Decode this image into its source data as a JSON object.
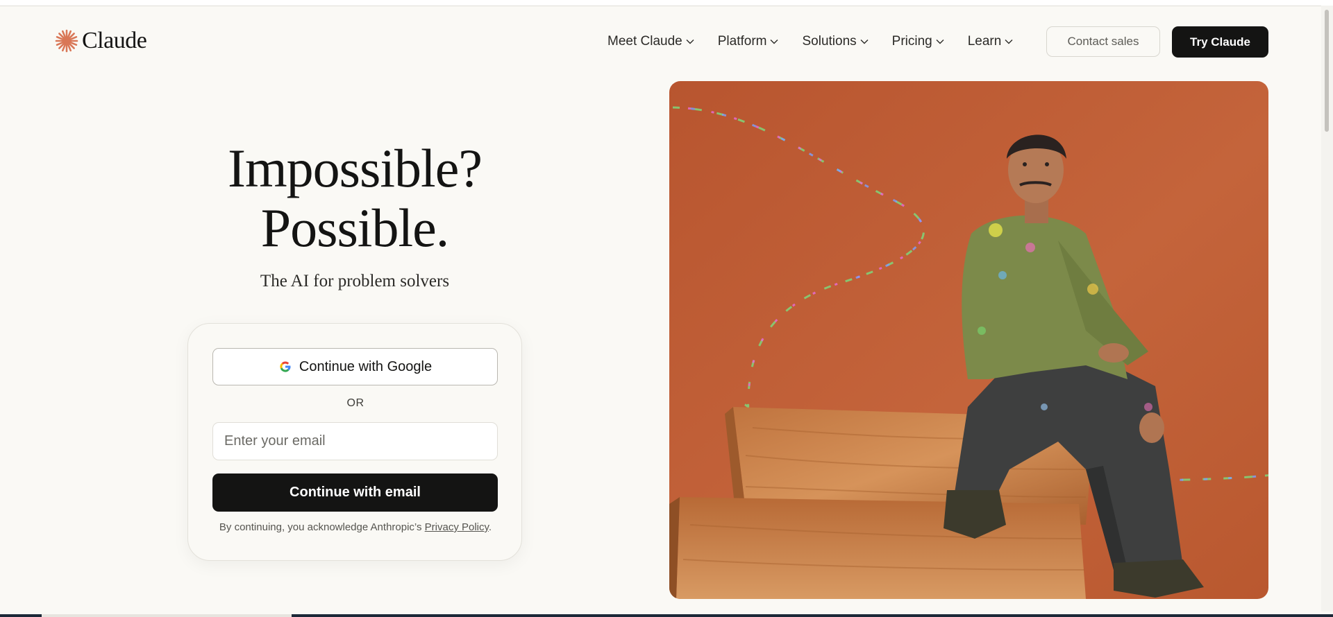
{
  "brand": {
    "name": "Claude",
    "logo_icon": "claude-spark-icon",
    "accent": "#d97757"
  },
  "nav": {
    "items": [
      {
        "label": "Meet Claude",
        "icon": "chevron-down-icon"
      },
      {
        "label": "Platform",
        "icon": "chevron-down-icon"
      },
      {
        "label": "Solutions",
        "icon": "chevron-down-icon"
      },
      {
        "label": "Pricing",
        "icon": "chevron-down-icon"
      },
      {
        "label": "Learn",
        "icon": "chevron-down-icon"
      }
    ],
    "contact_label": "Contact sales",
    "try_label": "Try Claude"
  },
  "hero": {
    "title_line1": "Impossible?",
    "title_line2": "Possible.",
    "subtitle": "The AI for problem solvers"
  },
  "signin": {
    "google_label": "Continue with Google",
    "google_icon": "google-g-icon",
    "divider": "OR",
    "email_placeholder": "Enter your email",
    "email_value": "",
    "email_button": "Continue with email",
    "legal_prefix": "By continuing, you acknowledge Anthropic’s ",
    "legal_link": "Privacy Policy",
    "legal_suffix": "."
  },
  "colors": {
    "page_bg": "#faf9f5",
    "dark": "#141413",
    "photo_bg": "#c0613a"
  }
}
